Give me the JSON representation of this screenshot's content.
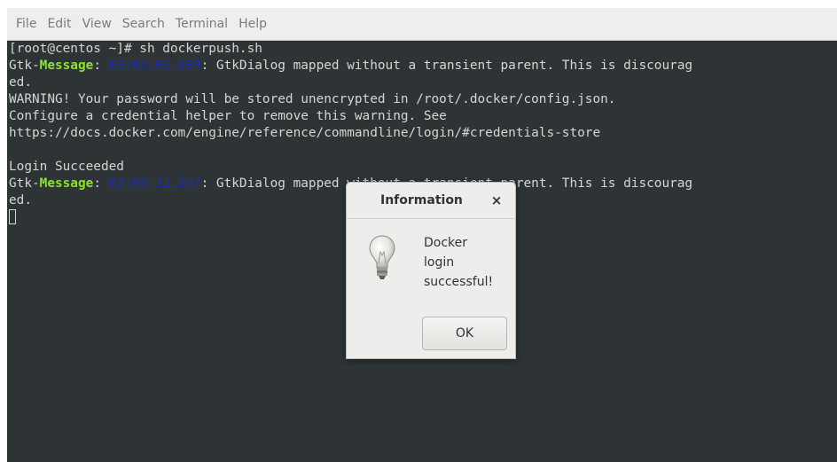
{
  "menubar": {
    "items": [
      "File",
      "Edit",
      "View",
      "Search",
      "Terminal",
      "Help"
    ]
  },
  "terminal": {
    "lines": [
      {
        "segments": [
          {
            "t": "[root@centos ~]# sh dockerpush.sh",
            "c": "plain"
          }
        ]
      },
      {
        "segments": [
          {
            "t": "Gtk-",
            "c": "plain"
          },
          {
            "t": "Message",
            "c": "msg"
          },
          {
            "t": ": ",
            "c": "plain"
          },
          {
            "t": "03:05:05.609",
            "c": "time"
          },
          {
            "t": ": GtkDialog mapped without a transient parent. This is discourag",
            "c": "plain"
          }
        ]
      },
      {
        "segments": [
          {
            "t": "ed.",
            "c": "plain"
          }
        ]
      },
      {
        "segments": [
          {
            "t": "WARNING! Your password will be stored unencrypted in /root/.docker/config.json.",
            "c": "plain"
          }
        ]
      },
      {
        "segments": [
          {
            "t": "Configure a credential helper to remove this warning. See",
            "c": "plain"
          }
        ]
      },
      {
        "segments": [
          {
            "t": "https://docs.docker.com/engine/reference/commandline/login/#credentials-store",
            "c": "plain"
          }
        ]
      },
      {
        "segments": [
          {
            "t": "",
            "c": "plain"
          }
        ]
      },
      {
        "segments": [
          {
            "t": "Login Succeeded",
            "c": "plain"
          }
        ]
      },
      {
        "segments": [
          {
            "t": "Gtk-",
            "c": "plain"
          },
          {
            "t": "Message",
            "c": "msg"
          },
          {
            "t": ": ",
            "c": "plain"
          },
          {
            "t": "03:06:32.207",
            "c": "time"
          },
          {
            "t": ": GtkDialog mapped without a transient parent. This is discourag",
            "c": "plain"
          }
        ]
      },
      {
        "segments": [
          {
            "t": "ed.",
            "c": "plain"
          }
        ]
      },
      {
        "segments": [
          {
            "t": "",
            "c": "cursor"
          }
        ]
      }
    ],
    "colors": {
      "background": "#2e3436",
      "text": "#d3d7cf",
      "message": "#8ae234",
      "timestamp": "#1a2bbd"
    }
  },
  "dialog": {
    "title": "Information",
    "close_label": "×",
    "icon": "lightbulb-icon",
    "message": "Docker\nlogin\nsuccessful!",
    "ok_label": "OK"
  }
}
